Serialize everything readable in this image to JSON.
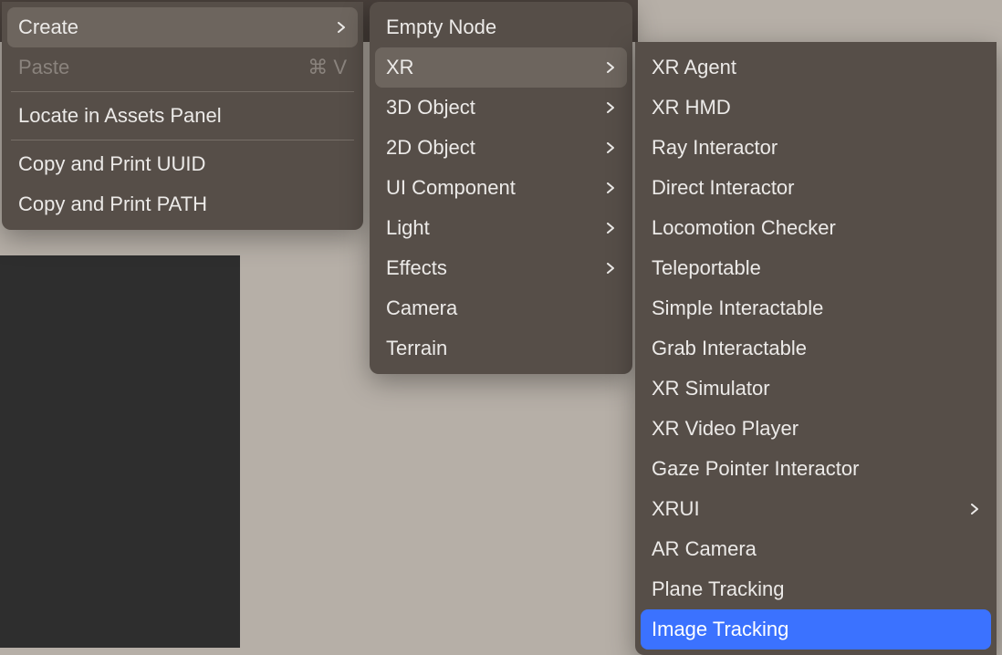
{
  "menu1": {
    "create": {
      "label": "Create"
    },
    "paste": {
      "label": "Paste",
      "shortcut": "⌘ V"
    },
    "locate": {
      "label": "Locate in Assets Panel"
    },
    "copy_uuid": {
      "label": "Copy and Print UUID"
    },
    "copy_path": {
      "label": "Copy and Print PATH"
    }
  },
  "menu2": {
    "empty_node": {
      "label": "Empty Node"
    },
    "xr": {
      "label": "XR"
    },
    "object_3d": {
      "label": "3D Object"
    },
    "object_2d": {
      "label": "2D Object"
    },
    "ui_component": {
      "label": "UI Component"
    },
    "light": {
      "label": "Light"
    },
    "effects": {
      "label": "Effects"
    },
    "camera": {
      "label": "Camera"
    },
    "terrain": {
      "label": "Terrain"
    }
  },
  "menu3": {
    "xr_agent": {
      "label": "XR Agent"
    },
    "xr_hmd": {
      "label": "XR HMD"
    },
    "ray_interactor": {
      "label": "Ray Interactor"
    },
    "direct_interactor": {
      "label": "Direct Interactor"
    },
    "locomotion_checker": {
      "label": "Locomotion Checker"
    },
    "teleportable": {
      "label": "Teleportable"
    },
    "simple_interactable": {
      "label": "Simple Interactable"
    },
    "grab_interactable": {
      "label": "Grab Interactable"
    },
    "xr_simulator": {
      "label": "XR Simulator"
    },
    "xr_video_player": {
      "label": "XR Video Player"
    },
    "gaze_pointer_interactor": {
      "label": "Gaze Pointer Interactor"
    },
    "xrui": {
      "label": "XRUI"
    },
    "ar_camera": {
      "label": "AR Camera"
    },
    "plane_tracking": {
      "label": "Plane Tracking"
    },
    "image_tracking": {
      "label": "Image Tracking"
    }
  }
}
